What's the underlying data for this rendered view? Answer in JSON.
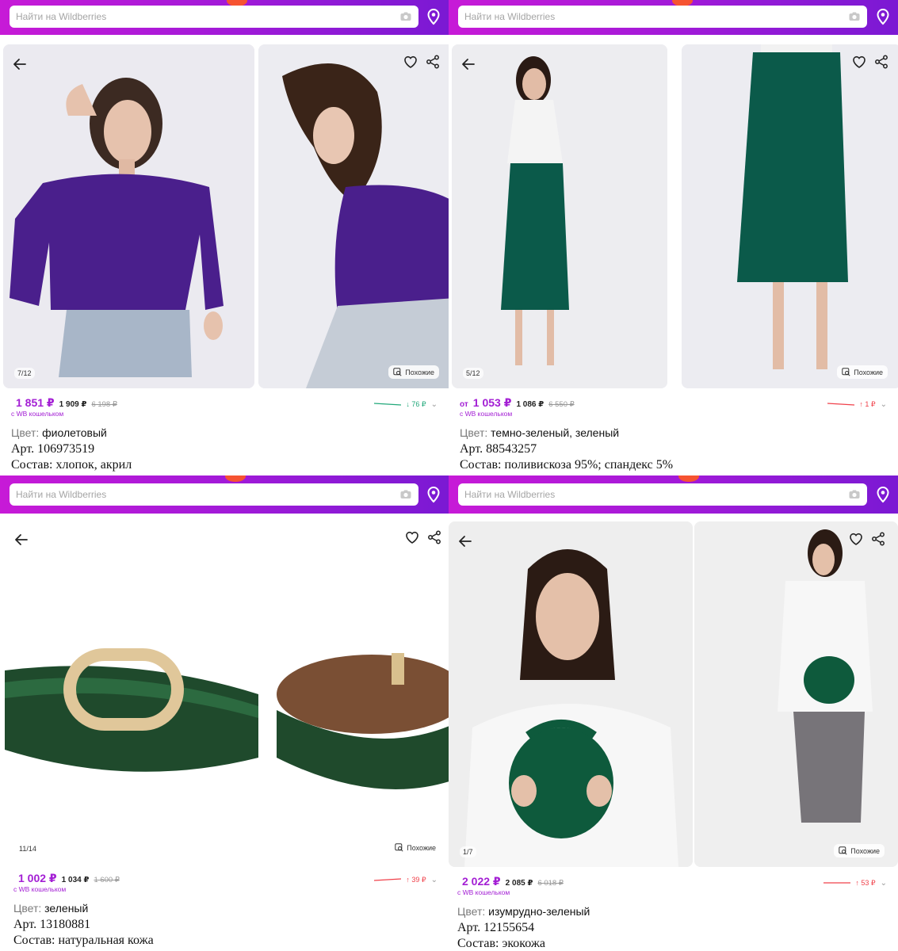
{
  "search_placeholder": "Найти на Wildberries",
  "similar_label": "Похожие",
  "wallet_note": "с WB кошельком",
  "colors": {
    "accent": "#a31ed4",
    "price_down": "#21a87a",
    "price_up": "#f0404a"
  },
  "products": [
    {
      "counter": "7/12",
      "price_from": "",
      "price_wallet": "1 851 ₽",
      "price_main": "1 909 ₽",
      "price_old": "6 198 ₽",
      "delta": "↓ 76 ₽",
      "delta_dir": "down",
      "color_key": "Цвет:",
      "color_val": "фиолетовый",
      "article": "Арт. 106973519",
      "composition": "Состав: хлопок, акрил"
    },
    {
      "counter": "5/12",
      "price_from": "от",
      "price_wallet": "1 053 ₽",
      "price_main": "1 086 ₽",
      "price_old": "6 550 ₽",
      "delta": "↑ 1 ₽",
      "delta_dir": "up",
      "color_key": "Цвет:",
      "color_val": "темно-зеленый, зеленый",
      "article": "Арт. 88543257",
      "composition": "Состав: поливискоза 95%; спандекс 5%"
    },
    {
      "counter": "11/14",
      "price_from": "",
      "price_wallet": "1 002 ₽",
      "price_main": "1 034 ₽",
      "price_old": "1 600 ₽",
      "delta": "↑ 39 ₽",
      "delta_dir": "up",
      "color_key": "Цвет:",
      "color_val": "зеленый",
      "article": "Арт. 13180881",
      "composition": "Состав: натуральная кожа"
    },
    {
      "counter": "1/7",
      "price_from": "",
      "price_wallet": "2 022 ₽",
      "price_main": "2 085 ₽",
      "price_old": "6 018 ₽",
      "delta": "↑ 53 ₽",
      "delta_dir": "up",
      "color_key": "Цвет:",
      "color_val": "изумрудно-зеленый",
      "article": "Арт. 12155654",
      "composition": "Состав: экокожа"
    }
  ]
}
